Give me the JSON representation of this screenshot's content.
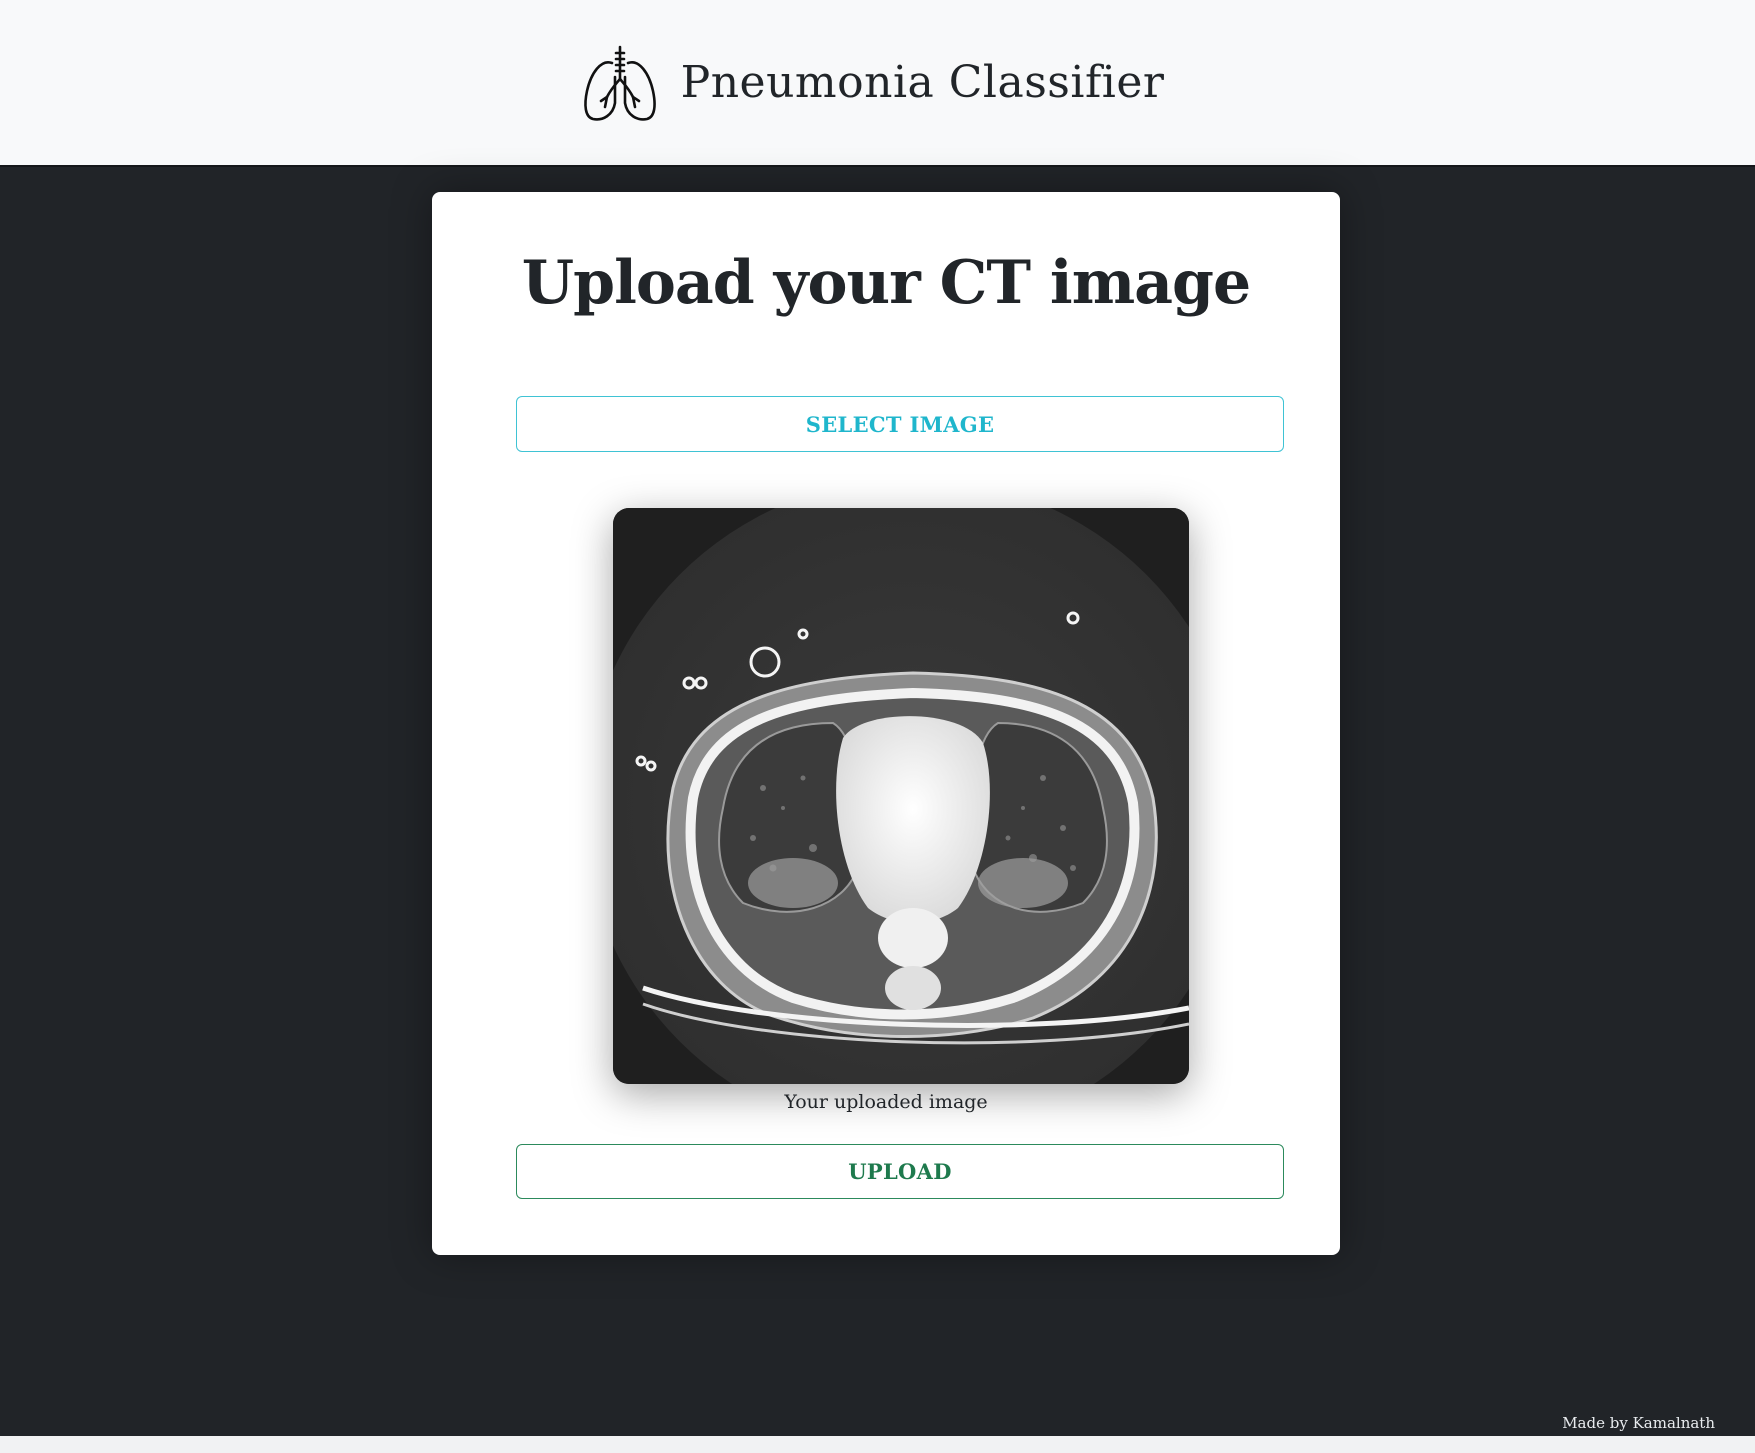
{
  "navbar": {
    "brand_title": "Pneumonia Classifier",
    "brand_icon": "lungs-icon"
  },
  "card": {
    "heading": "Upload your CT image",
    "select_button_label": "SELECT IMAGE",
    "preview_caption": "Your uploaded image",
    "upload_button_label": "UPLOAD"
  },
  "footer": {
    "credit": "Made by Kamalnath"
  },
  "colors": {
    "page_background": "#212428",
    "navbar_background": "#f8f9fa",
    "select_button_accent": "#1fb6cc",
    "upload_button_accent": "#1e7a4d"
  }
}
